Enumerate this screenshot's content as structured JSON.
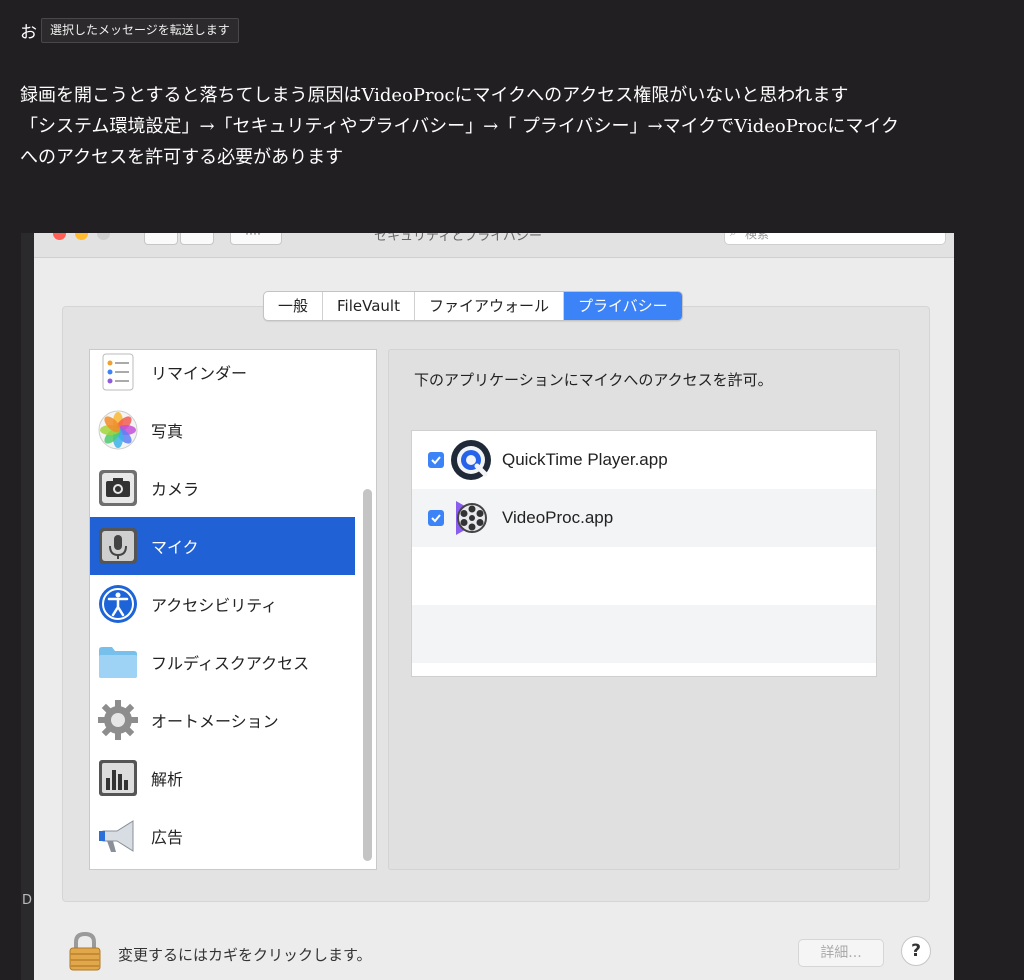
{
  "message": {
    "initial": "お",
    "forward_tooltip": "選択したメッセージを転送します",
    "lines": [
      "録画を開こうとすると落ちてしまう原因はVideoProcにマイクへのアクセス権限がいないと思われます",
      "「システム環境設定」→「セキュリティやプライバシー」→「 プライバシー」→マイクでVideoProcにマイク",
      "へのアクセスを許可する必要があります"
    ]
  },
  "window": {
    "title": "セキュリティとプライバシー",
    "all_button": "····",
    "search_placeholder": "検索",
    "side_letter": "D"
  },
  "tabs": [
    "一般",
    "FileVault",
    "ファイアウォール",
    "プライバシー"
  ],
  "active_tab": "プライバシー",
  "categories": [
    {
      "label": "リマインダー",
      "icon": "reminders-icon"
    },
    {
      "label": "写真",
      "icon": "photos-icon"
    },
    {
      "label": "カメラ",
      "icon": "camera-icon"
    },
    {
      "label": "マイク",
      "icon": "microphone-icon",
      "selected": true
    },
    {
      "label": "アクセシビリティ",
      "icon": "accessibility-icon"
    },
    {
      "label": "フルディスクアクセス",
      "icon": "folder-icon"
    },
    {
      "label": "オートメーション",
      "icon": "gear-icon"
    },
    {
      "label": "解析",
      "icon": "analytics-icon"
    },
    {
      "label": "広告",
      "icon": "megaphone-icon"
    }
  ],
  "permission_text": "下のアプリケーションにマイクへのアクセスを許可。",
  "apps": [
    {
      "name": "QuickTime Player.app",
      "checked": true,
      "icon": "quicktime-icon"
    },
    {
      "name": "VideoProc.app",
      "checked": true,
      "icon": "videoproc-icon"
    }
  ],
  "bottom": {
    "lock_text": "変更するにはカギをクリックします。",
    "detail_button": "詳細...",
    "help_button": "?"
  },
  "colors": {
    "page_bg": "#221f22",
    "accent": "#3b83f7",
    "selected_row": "#2061d6"
  }
}
